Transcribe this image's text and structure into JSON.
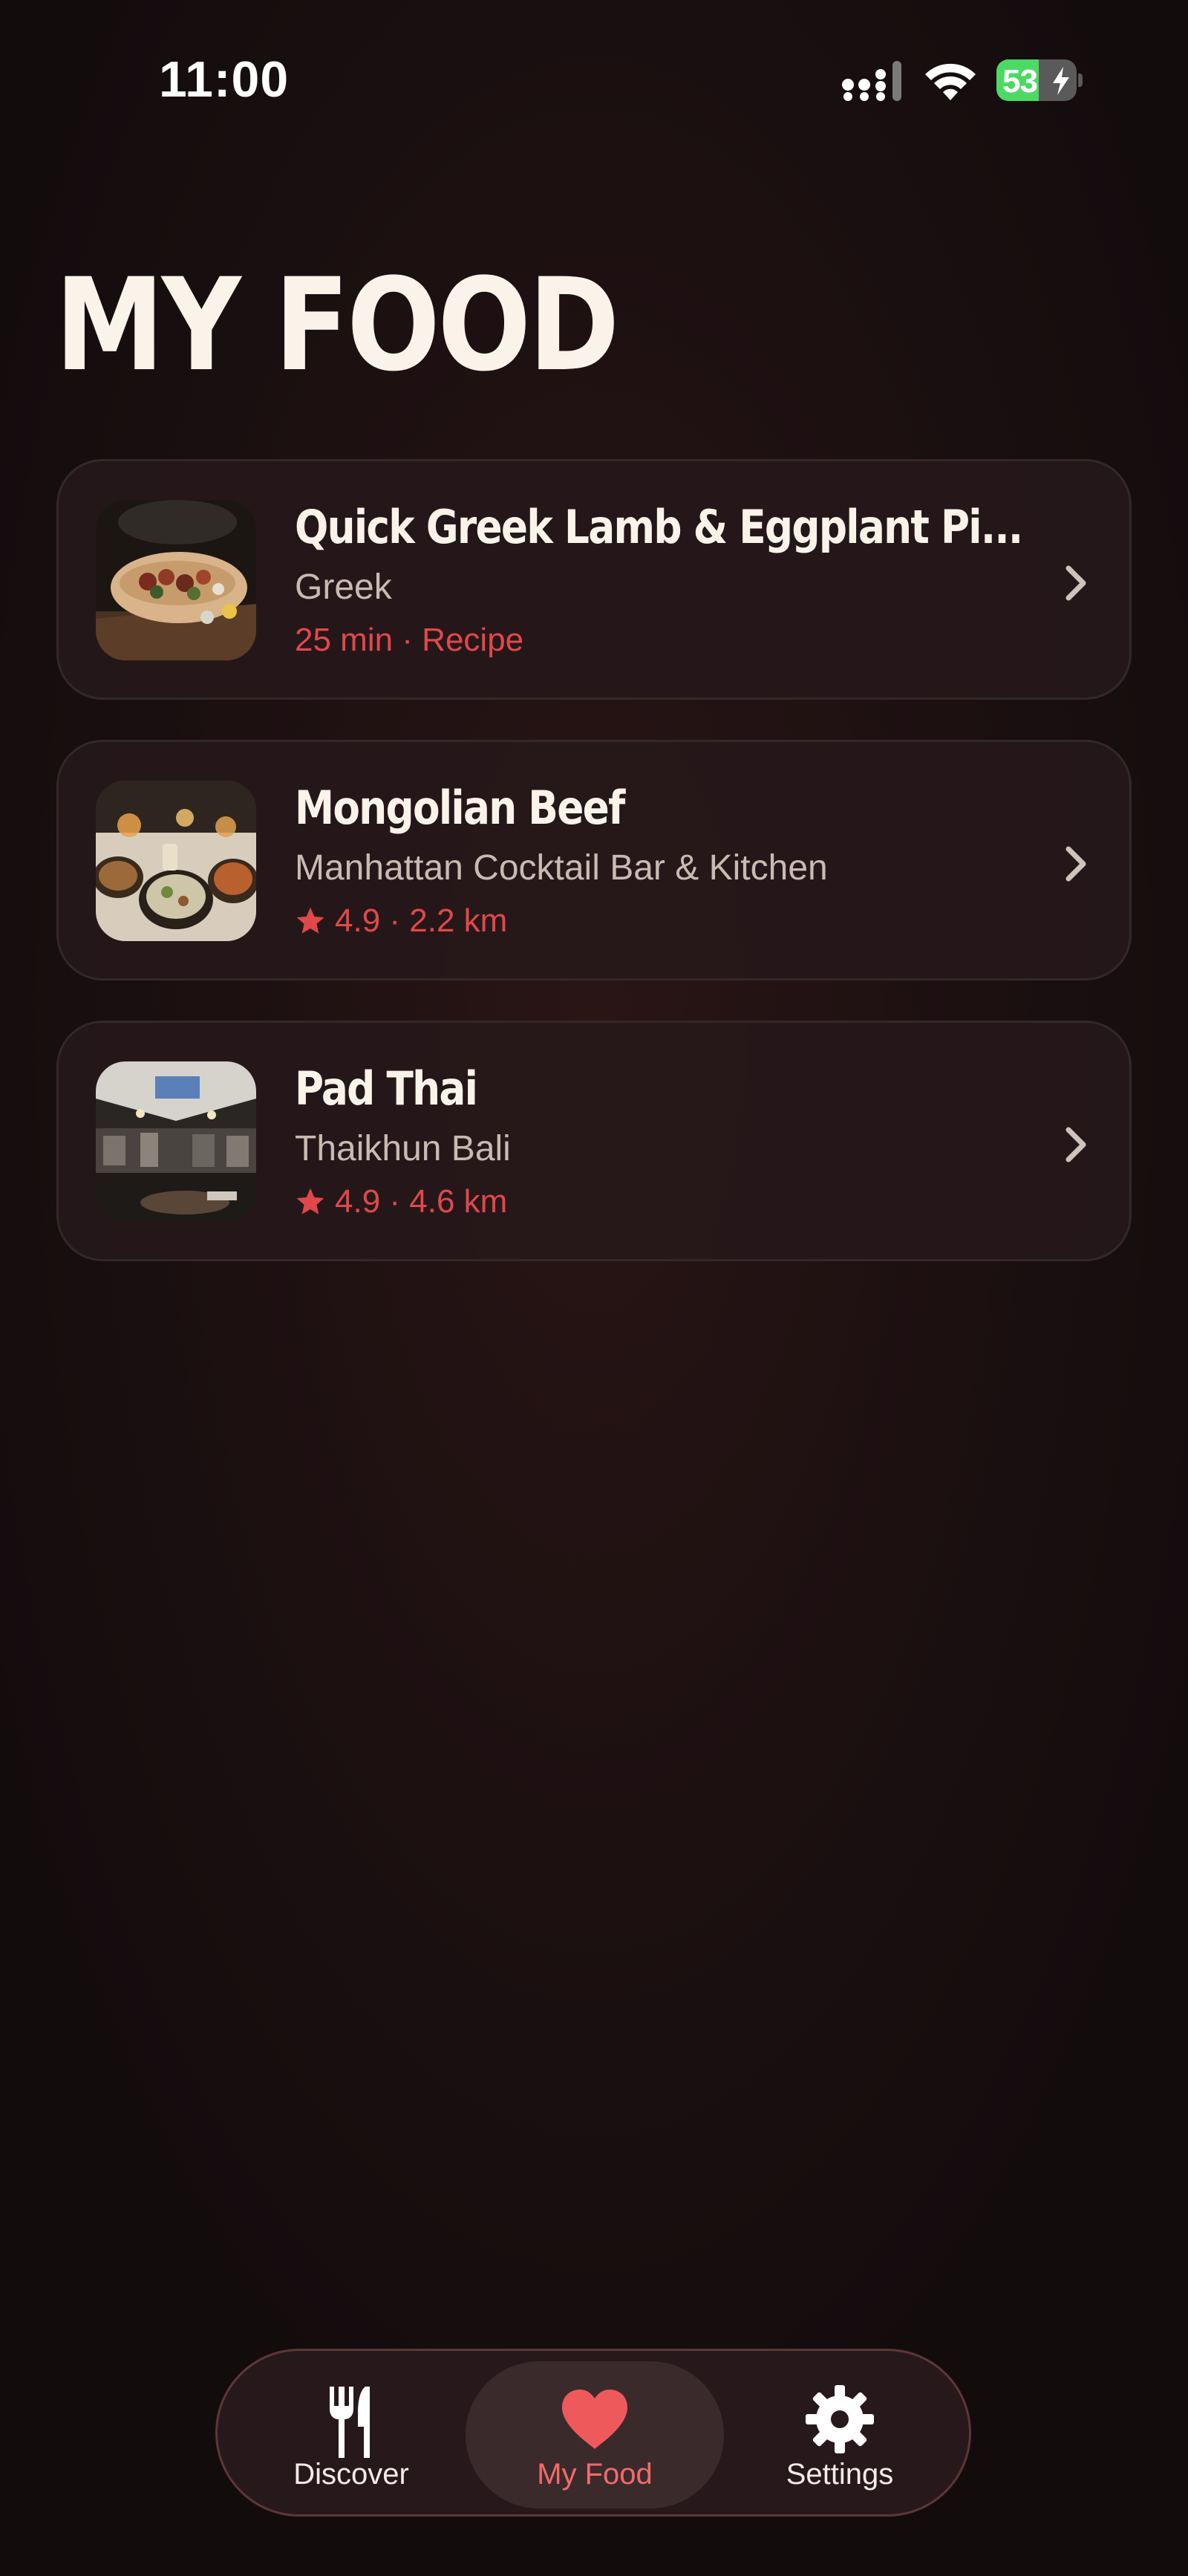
{
  "status_bar": {
    "time": "11:00",
    "battery_level": "53",
    "battery_fraction": 0.53,
    "icons": [
      "signal-icon",
      "wifi-icon",
      "battery-icon",
      "charging-bolt-icon"
    ]
  },
  "page": {
    "title": "MY FOOD"
  },
  "food_items": [
    {
      "name": "Quick Greek Lamb & Eggplant Pi...",
      "subtitle": "Greek",
      "meta": "25 min · Recipe",
      "has_star": false,
      "image": "pita-with-lamb-eggplant-photo"
    },
    {
      "name": "Mongolian Beef",
      "subtitle": "Manhattan Cocktail Bar & Kitchen",
      "meta": "4.9 · 2.2 km",
      "has_star": true,
      "image": "restaurant-table-dishes-photo"
    },
    {
      "name": "Pad Thai",
      "subtitle": "Thaikhun Bali",
      "meta": "4.9 · 4.6 km",
      "has_star": true,
      "image": "restaurant-interior-photo"
    }
  ],
  "tab_bar": {
    "tabs": [
      {
        "label": "Discover",
        "icon": "fork-knife-icon",
        "active": false
      },
      {
        "label": "My Food",
        "icon": "heart-icon",
        "active": true
      },
      {
        "label": "Settings",
        "icon": "gear-icon",
        "active": false
      }
    ]
  },
  "colors": {
    "accent": "#e0484a",
    "active_tab": "#f06b6b",
    "title": "#fbf3ea",
    "subtitle": "#c9bab2",
    "battery_green": "#4cd964"
  }
}
